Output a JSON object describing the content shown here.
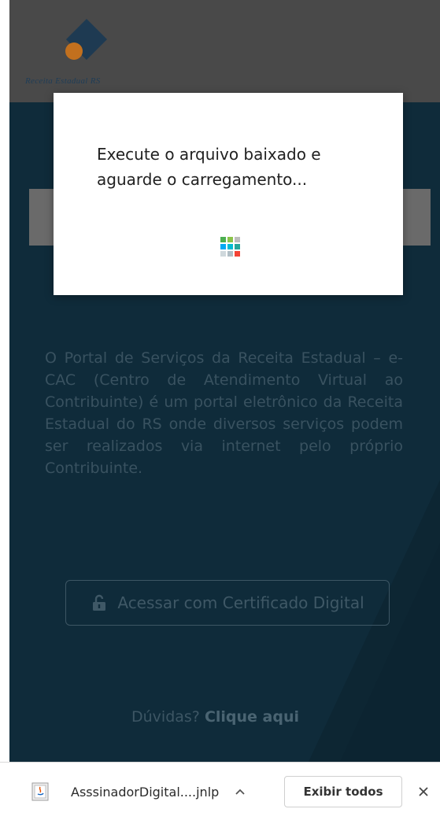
{
  "header": {
    "logo_text": "Receita Estadual RS"
  },
  "modal": {
    "message": "Execute o arquivo baixado e aguarde o carregamento...",
    "loader_icon": "loading-grid-icon"
  },
  "page": {
    "intro_text": "O Portal de Serviços da Receita Estadual – e-CAC (Centro de Atendimento Virtual ao Contribuinte) é um portal eletrônico da Receita Estadual do RS onde diversos serviços podem ser realizados via internet pelo próprio Contribuinte.",
    "cert_button_label": "Acessar com Certificado Digital",
    "cert_button_icon": "unlock-icon",
    "help_prefix": "Dúvidas?",
    "help_link": "Clique aqui"
  },
  "download_bar": {
    "filename": "AsssinadorDigital....jnlp",
    "file_icon": "java-file-icon",
    "show_all_label": "Exibir todos",
    "close_icon": "close-icon"
  },
  "colors": {
    "page_bg": "#0f2b3a",
    "header_bg": "#494949",
    "logo_blue": "#1f3d57",
    "logo_orange": "#c2701e"
  }
}
